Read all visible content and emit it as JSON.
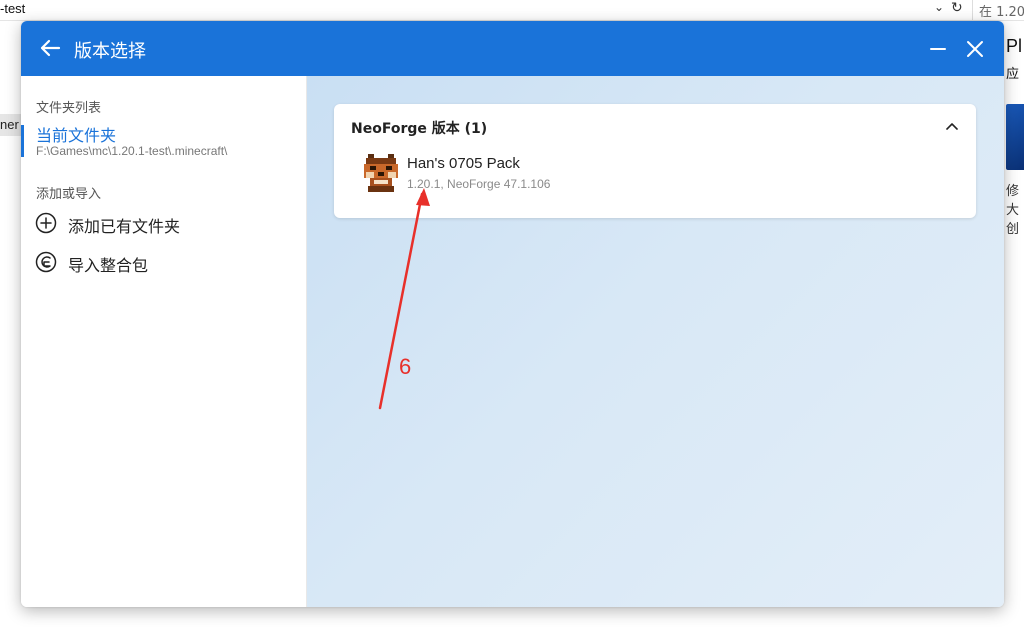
{
  "background": {
    "address_path": "-test",
    "search_text": "在 1.20",
    "left_tag": "ner",
    "right_title": "Pl",
    "right_sub": "应",
    "right_lines": [
      "修",
      "大",
      "创"
    ]
  },
  "dialog": {
    "title": "版本选择",
    "sidebar": {
      "folder_list_label": "文件夹列表",
      "current_folder": {
        "title": "当前文件夹",
        "path": "F:\\Games\\mc\\1.20.1-test\\.minecraft\\"
      },
      "add_import_label": "添加或导入",
      "actions": [
        {
          "label": "添加已有文件夹",
          "icon": "plus-circle-icon"
        },
        {
          "label": "导入整合包",
          "icon": "import-pack-icon"
        }
      ]
    },
    "main": {
      "group": {
        "header": "NeoForge 版本 (1)",
        "items": [
          {
            "name": "Han's 0705 Pack",
            "desc": "1.20.1, NeoForge 47.1.106",
            "icon": "fox-avatar-icon"
          }
        ]
      }
    }
  },
  "annotation": {
    "label": "6"
  },
  "colors": {
    "accent": "#1a73d9",
    "annotation": "#e8302a",
    "main_bg": "#d4e6f5"
  }
}
